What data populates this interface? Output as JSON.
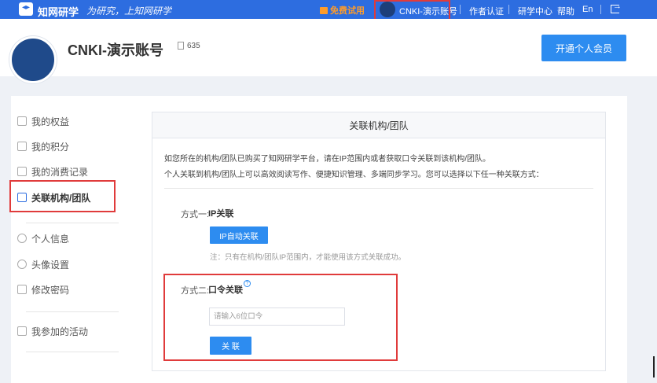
{
  "topbar": {
    "brand": "知网研学",
    "slogan": "为研究，上知网研学",
    "free_trial": "免费试用",
    "account_name": "CNKI-演示账号",
    "nav": [
      "作者认证",
      "研学中心",
      "帮助",
      "En"
    ]
  },
  "profile": {
    "name": "CNKI-演示账号",
    "count": "635",
    "vip_button": "开通个人会员"
  },
  "sidebar": {
    "items": [
      {
        "label": "我的权益",
        "icon": "diamond-icon"
      },
      {
        "label": "我的积分",
        "icon": "points-icon"
      },
      {
        "label": "我的消费记录",
        "icon": "receipt-icon"
      },
      {
        "label": "关联机构/团队",
        "icon": "institution-icon"
      },
      {
        "label": "个人信息",
        "icon": "user-icon"
      },
      {
        "label": "头像设置",
        "icon": "avatar-icon"
      },
      {
        "label": "修改密码",
        "icon": "lock-icon"
      },
      {
        "label": "我参加的活动",
        "icon": "activity-icon"
      }
    ]
  },
  "content": {
    "title": "关联机构/团队",
    "intro1": "如您所在的机构/团队已购买了知网研学平台，请在IP范围内或者获取口令关联到该机构/团队。",
    "intro2": "个人关联到机构/团队上可以高效阅读写作、便捷知识管理、多端同步学习。您可以选择以下任一种关联方式：",
    "method1_label": "方式一:",
    "method1_title": "IP关联",
    "ip_button": "IP自动关联",
    "note": "注：只有在机构/团队IP范围内，才能使用该方式关联成功。",
    "method2_label": "方式二:",
    "method2_title": "口令关联",
    "code_placeholder": "请输入6位口令",
    "link_button": "关 联"
  }
}
